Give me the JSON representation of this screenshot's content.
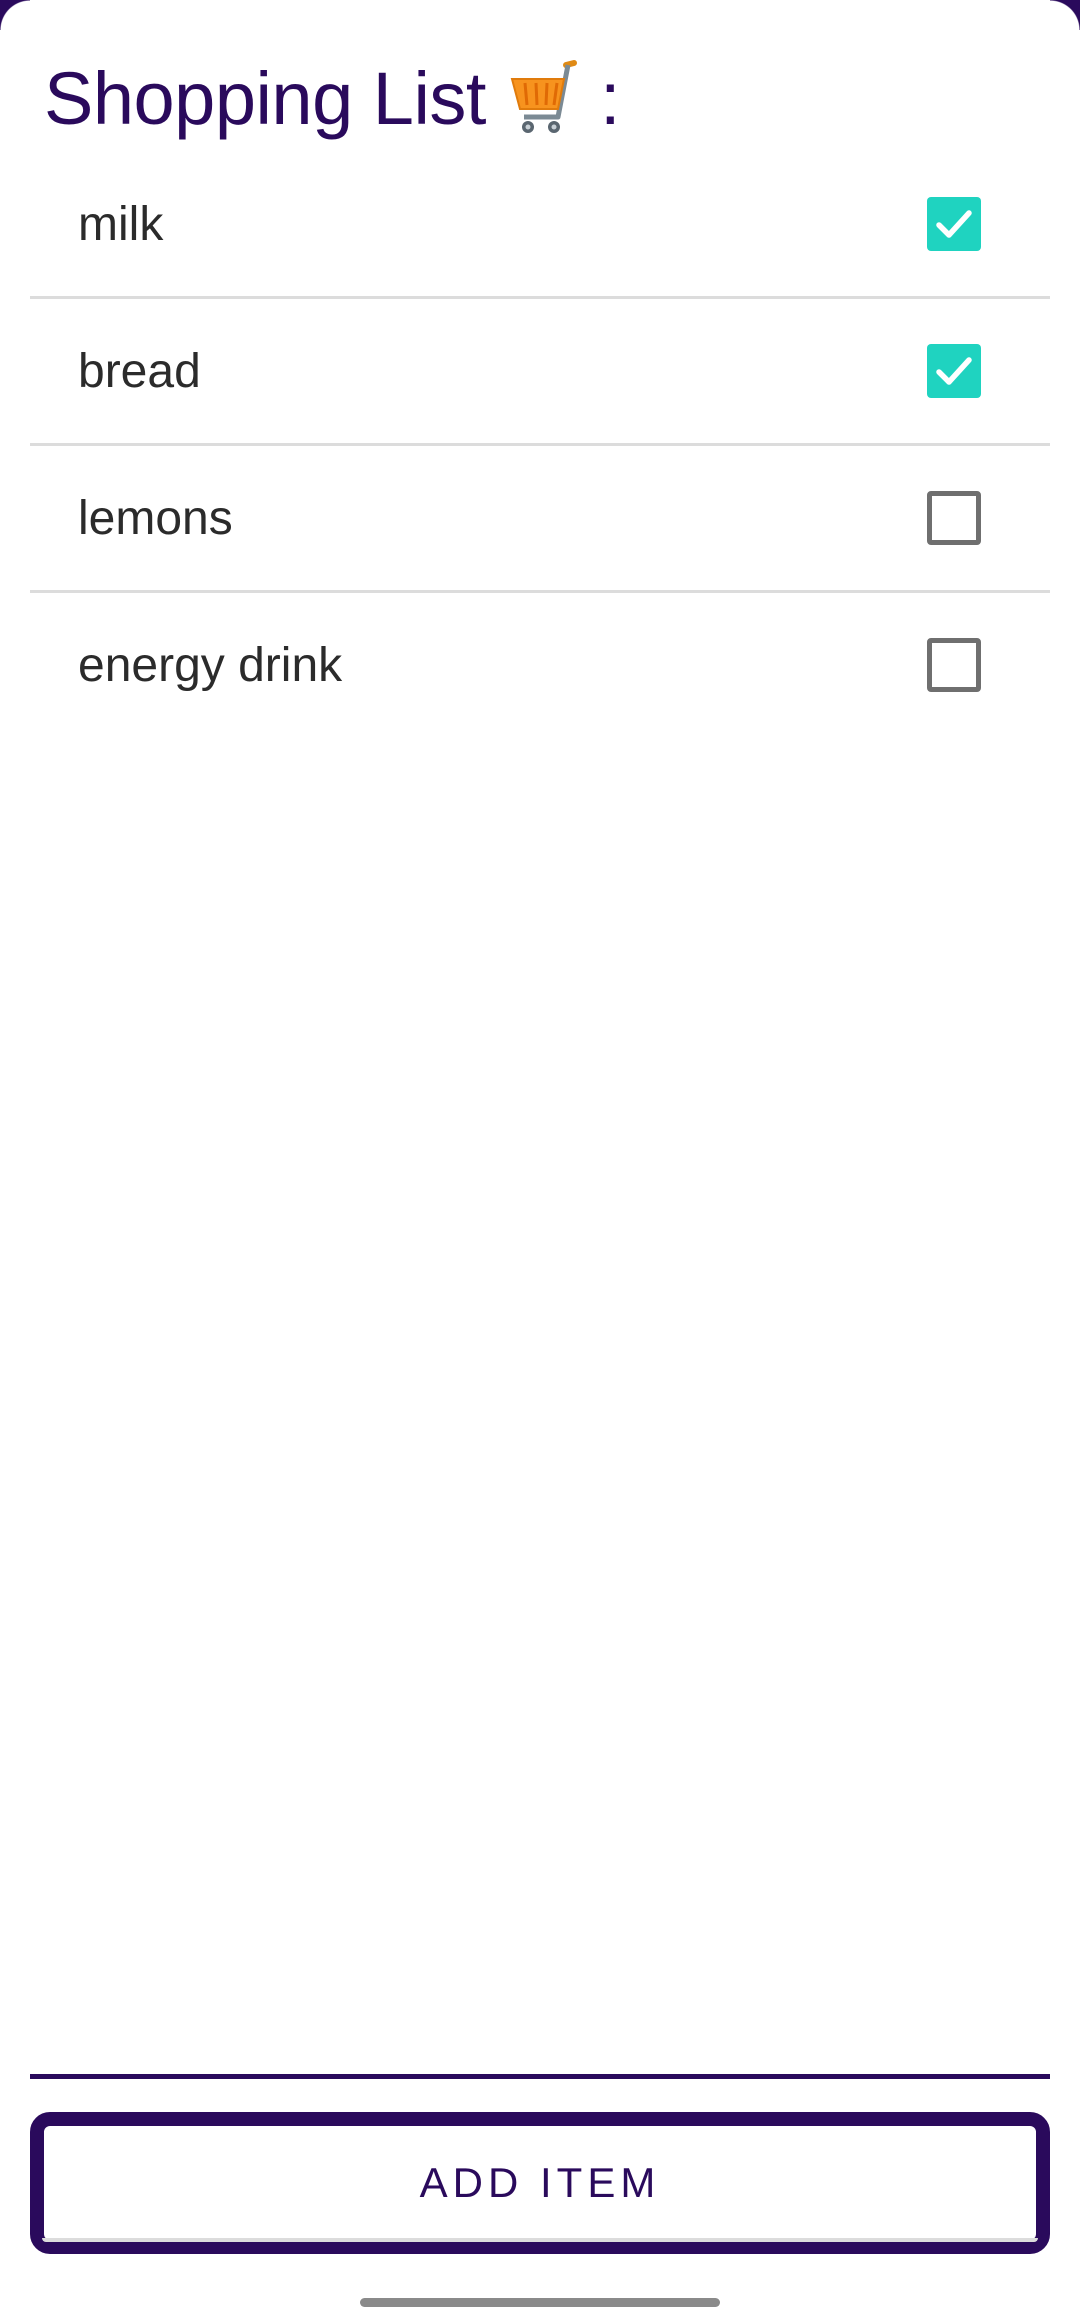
{
  "header": {
    "title": "Shopping List",
    "title_icon": "shopping-cart-icon",
    "title_suffix": ":"
  },
  "items": [
    {
      "label": "milk",
      "checked": true
    },
    {
      "label": "bread",
      "checked": true
    },
    {
      "label": "lemons",
      "checked": false
    },
    {
      "label": "energy drink",
      "checked": false
    }
  ],
  "footer": {
    "add_button_label": "ADD ITEM"
  },
  "colors": {
    "accent": "#2a0a5c",
    "checkbox_checked": "#1fd3c0",
    "checkbox_unchecked_border": "#6f6f6f"
  }
}
